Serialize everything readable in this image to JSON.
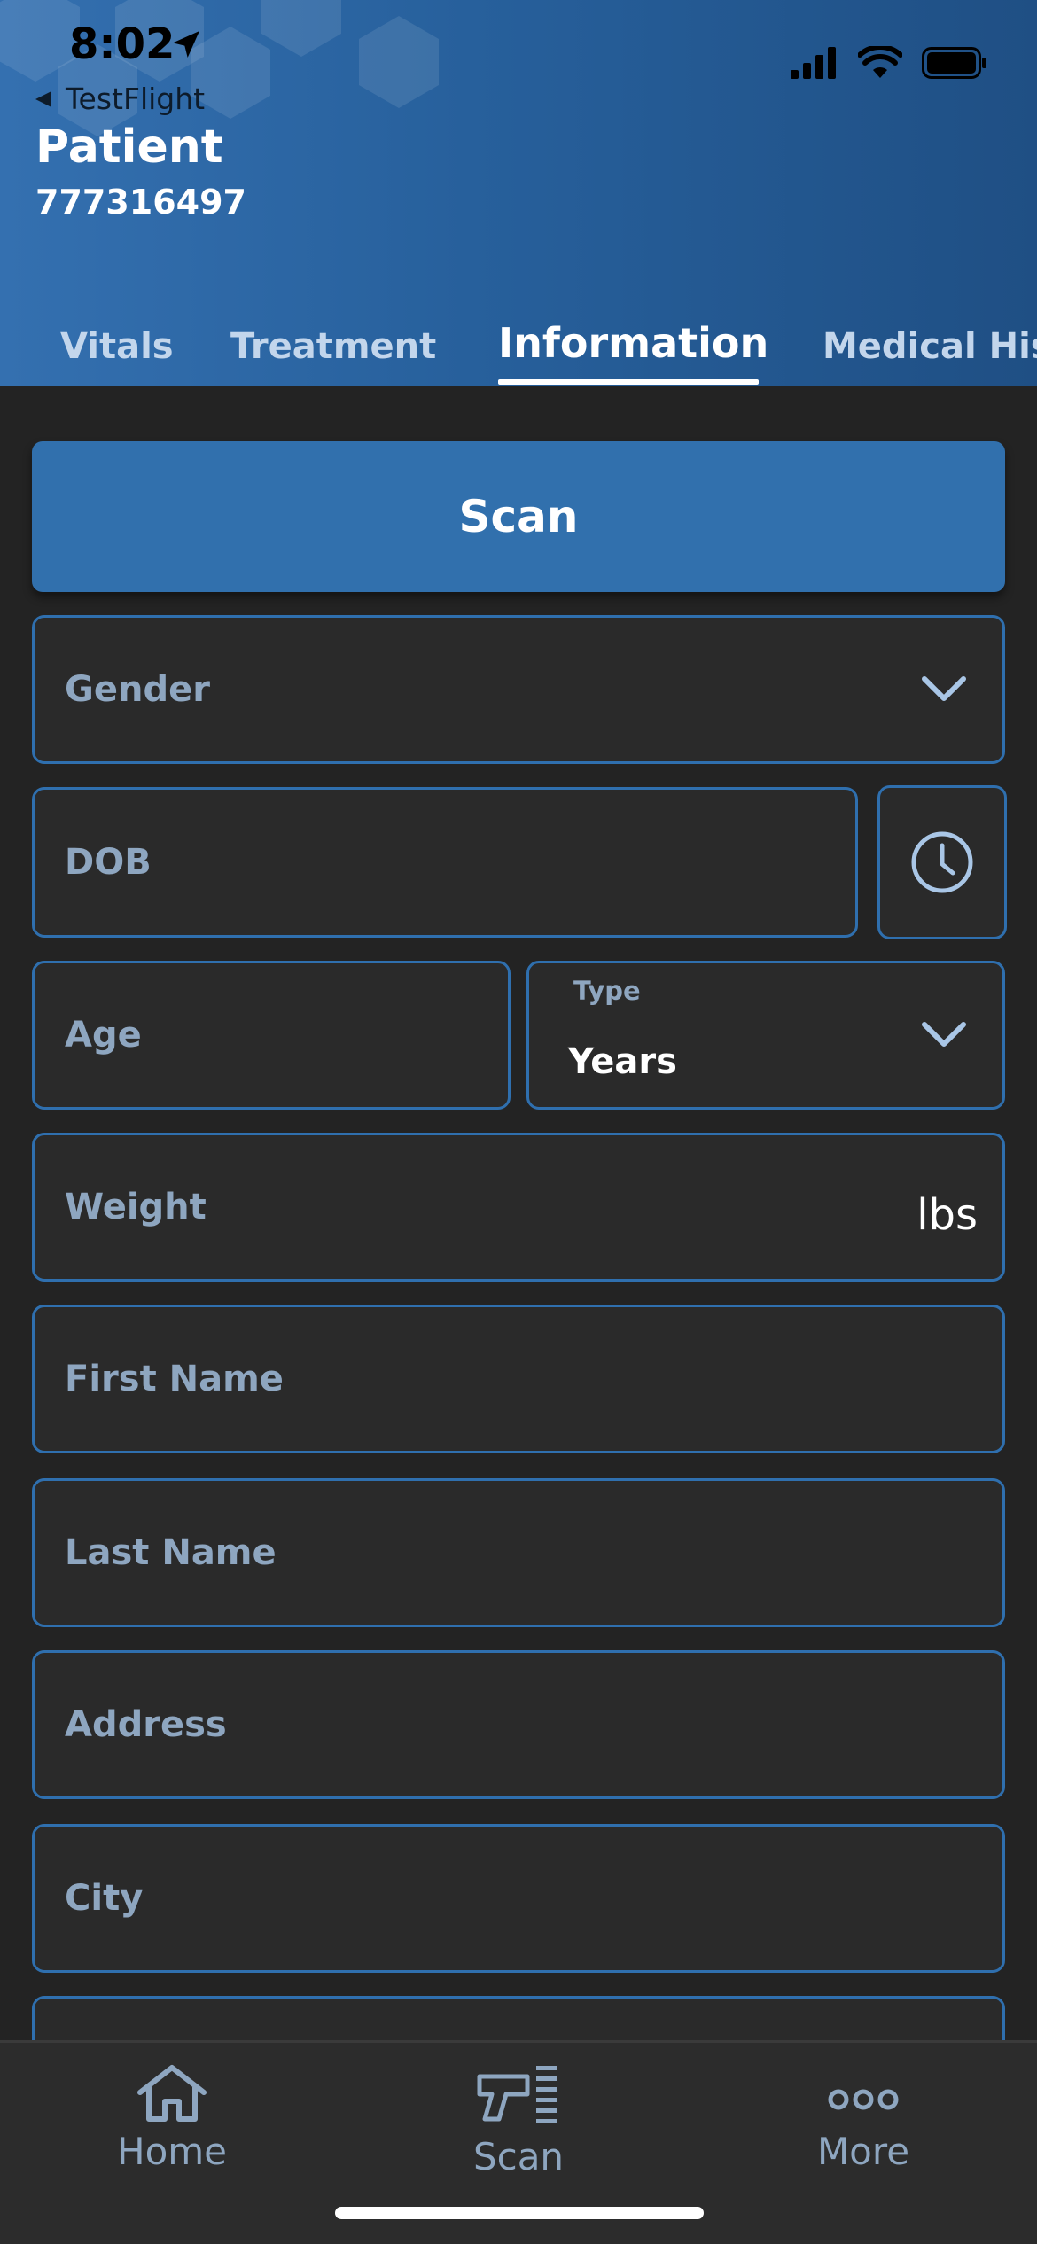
{
  "status_bar": {
    "time": "8:02"
  },
  "header": {
    "back_label": "TestFlight",
    "title": "Patient",
    "patient_id": "777316497"
  },
  "tabs": [
    {
      "label": "Vitals",
      "active": false
    },
    {
      "label": "Treatment",
      "active": false
    },
    {
      "label": "Information",
      "active": true
    },
    {
      "label": "Medical His",
      "active": false
    }
  ],
  "form": {
    "scan_label": "Scan",
    "gender_placeholder": "Gender",
    "dob_placeholder": "DOB",
    "age_placeholder": "Age",
    "type_label": "Type",
    "type_value": "Years",
    "weight_placeholder": "Weight",
    "weight_unit": "lbs",
    "first_name_placeholder": "First Name",
    "last_name_placeholder": "Last Name",
    "address_placeholder": "Address",
    "city_placeholder": "City"
  },
  "bottom_nav": [
    {
      "label": "Home",
      "icon": "home-icon"
    },
    {
      "label": "Scan",
      "icon": "barcode-scanner-icon"
    },
    {
      "label": "More",
      "icon": "more-dots-icon"
    }
  ],
  "colors": {
    "accent": "#3170ad",
    "field_border": "#2f6fae",
    "background": "#232323",
    "placeholder": "#8ea6c0"
  }
}
